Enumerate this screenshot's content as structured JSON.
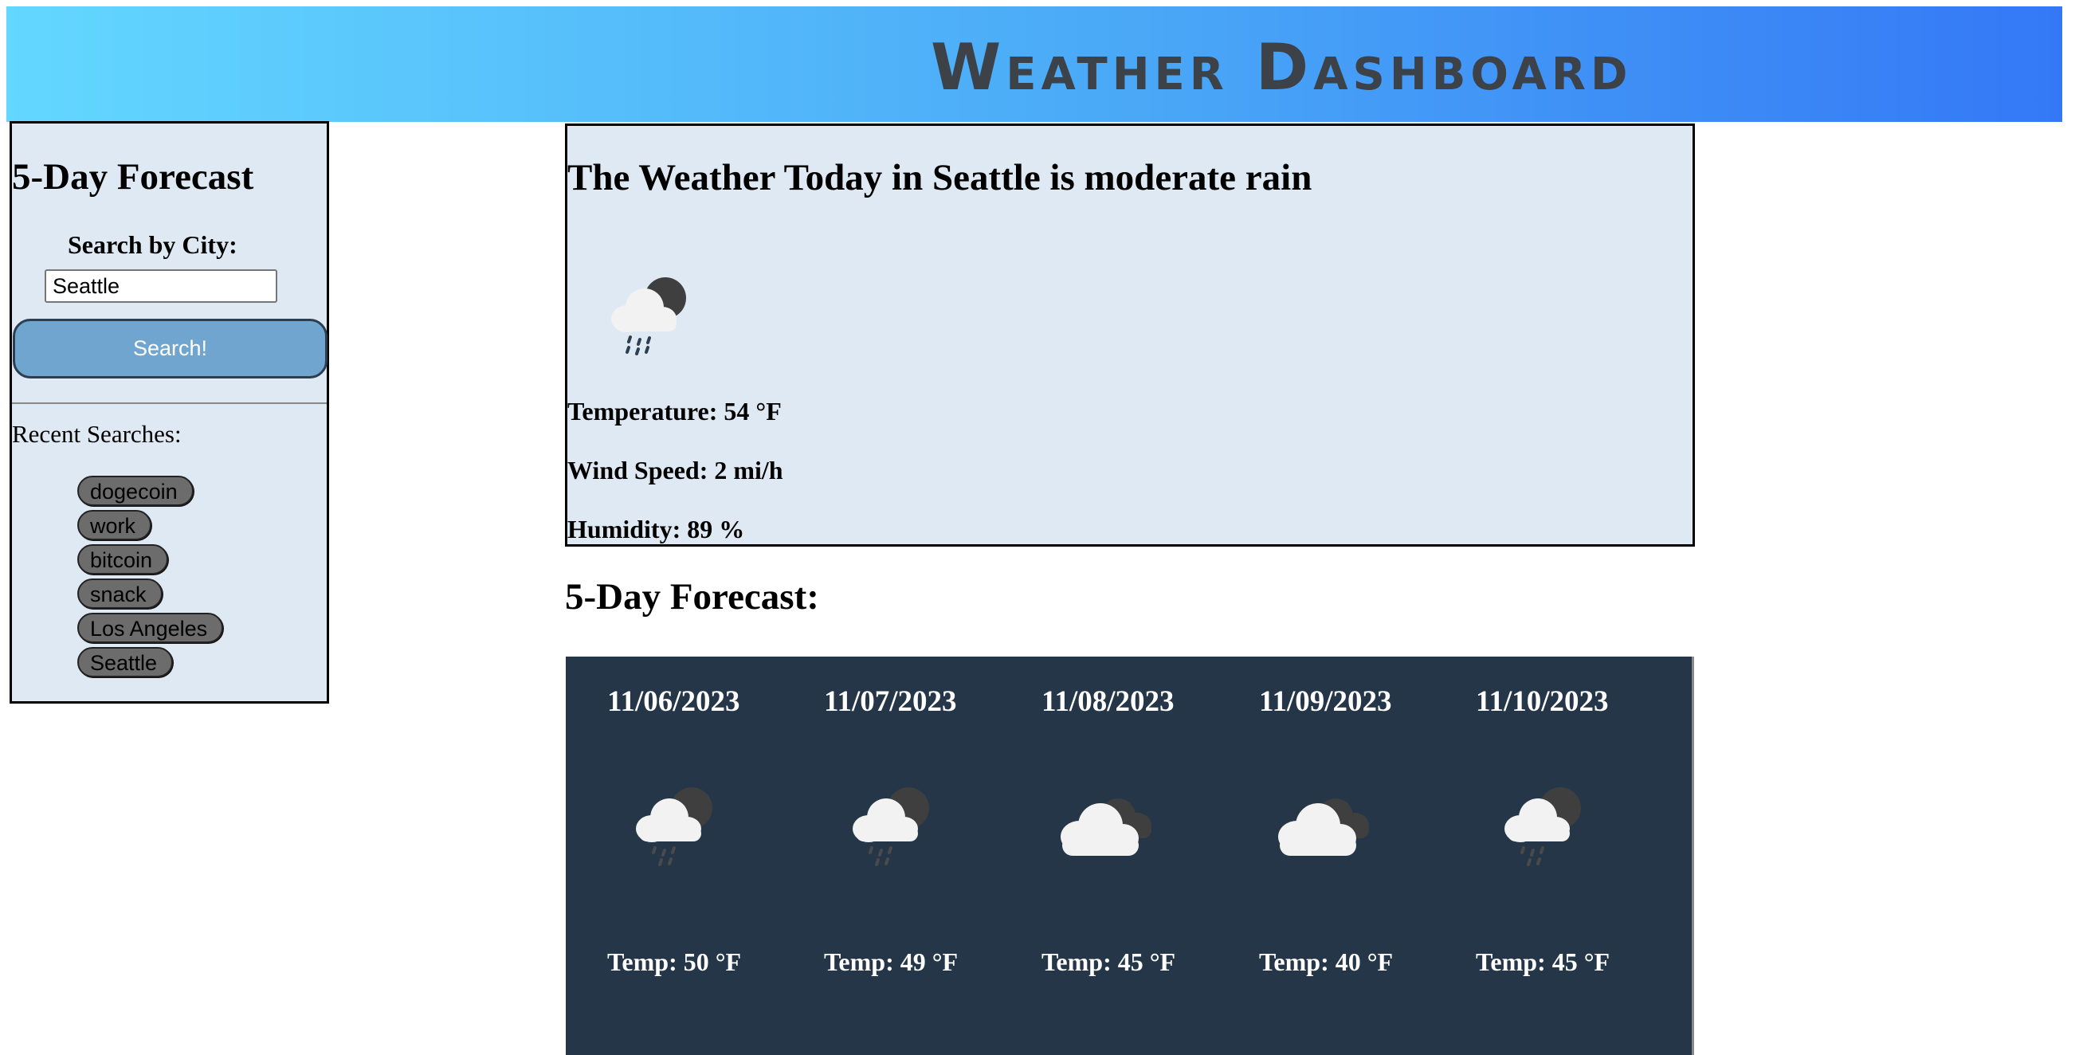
{
  "header": {
    "title": "Weather Dashboard"
  },
  "sidebar": {
    "title": "5-Day Forecast",
    "search_label": "Search by City:",
    "search_value": "Seattle",
    "search_button": "Search!",
    "recent_label": "Recent Searches:",
    "recent": [
      "dogecoin",
      "work",
      "bitcoin",
      "snack",
      "Los Angeles",
      "Seattle"
    ]
  },
  "today": {
    "title": "The Weather Today in Seattle is moderate rain",
    "icon": "rain-cloud-moon-icon",
    "temperature": "Temperature: 54 °F",
    "wind": "Wind Speed: 2 mi/h",
    "humidity": "Humidity: 89 %"
  },
  "forecast": {
    "heading": "5-Day Forecast:",
    "days": [
      {
        "date": "11/06/2023",
        "temp": "Temp: 50 °F",
        "icon": "rain-cloud-moon-icon"
      },
      {
        "date": "11/07/2023",
        "temp": "Temp: 49 °F",
        "icon": "rain-cloud-moon-icon"
      },
      {
        "date": "11/08/2023",
        "temp": "Temp: 45 °F",
        "icon": "broken-clouds-icon"
      },
      {
        "date": "11/09/2023",
        "temp": "Temp: 40 °F",
        "icon": "broken-clouds-icon"
      },
      {
        "date": "11/10/2023",
        "temp": "Temp: 45 °F",
        "icon": "rain-cloud-moon-icon"
      }
    ]
  },
  "colors": {
    "header_gradient_start": "#63d7ff",
    "header_gradient_end": "#3478f6",
    "panel_background": "#dfe9f3",
    "forecast_background": "#243647",
    "button_background": "#70a5cf",
    "pill_background": "#6c6c6c"
  }
}
